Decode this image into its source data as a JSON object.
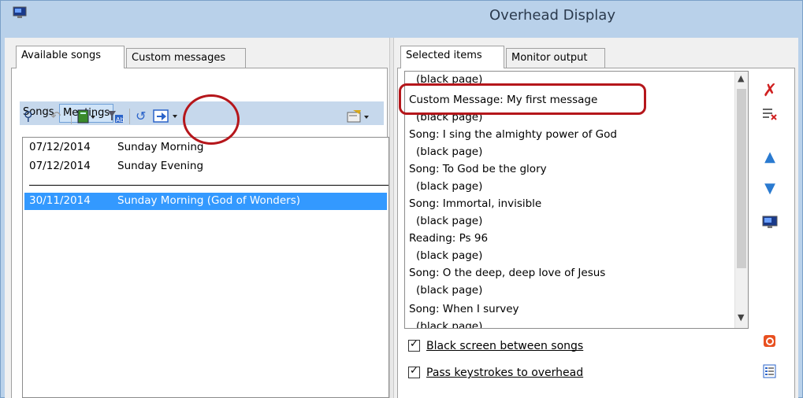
{
  "window": {
    "title": "Overhead Display"
  },
  "left_tabs": [
    {
      "label": "Available songs",
      "active": true
    },
    {
      "label": "Custom messages",
      "active": false
    }
  ],
  "sub_tabs": [
    {
      "label": "Songs",
      "active": false
    },
    {
      "label": "Meetings",
      "active": true
    }
  ],
  "toolbar_icons": [
    "binoculars-icon",
    "undo-icon",
    "book-icon",
    "filter-icon",
    "refresh-icon",
    "send-to-display-icon",
    "properties-icon"
  ],
  "meetings": [
    {
      "date": "07/12/2014",
      "name": "Sunday Morning",
      "selected": false
    },
    {
      "date": "07/12/2014",
      "name": "Sunday Evening",
      "selected": false
    },
    {
      "date": "30/11/2014",
      "name": "Sunday Morning (God of Wonders)",
      "selected": true
    }
  ],
  "right_tabs": [
    {
      "label": "Selected items",
      "active": true
    },
    {
      "label": "Monitor output",
      "active": false
    }
  ],
  "selected_items": [
    {
      "text": "(black page)",
      "indent": true
    },
    {
      "text": "Custom Message: My first message",
      "indent": false
    },
    {
      "text": "(black page)",
      "indent": true
    },
    {
      "text": "Song: I sing the almighty power of God",
      "indent": false
    },
    {
      "text": "(black page)",
      "indent": true
    },
    {
      "text": "Song: To God be the glory",
      "indent": false
    },
    {
      "text": "(black page)",
      "indent": true
    },
    {
      "text": "Song: Immortal, invisible",
      "indent": false
    },
    {
      "text": "(black page)",
      "indent": true
    },
    {
      "text": "Reading: Ps 96",
      "indent": false
    },
    {
      "text": "(black page)",
      "indent": true
    },
    {
      "text": "Song: O the deep, deep love of Jesus",
      "indent": false
    },
    {
      "text": "(black page)",
      "indent": true
    },
    {
      "text": "Song: When I survey",
      "indent": false
    },
    {
      "text": "(black page)",
      "indent": true
    }
  ],
  "options": {
    "black_screen": {
      "label": "Black screen between songs",
      "checked": true
    },
    "pass_keystrokes": {
      "label": "Pass keystrokes to overhead",
      "checked": true
    }
  },
  "side_buttons": [
    "remove-item-icon",
    "clear-items-icon",
    "move-up-icon",
    "move-down-icon",
    "monitor-icon",
    "display-logo-icon",
    "list-icon"
  ],
  "colors": {
    "selection": "#3399ff",
    "annotation": "#b5161b",
    "titlebar": "#b9d1ea"
  }
}
